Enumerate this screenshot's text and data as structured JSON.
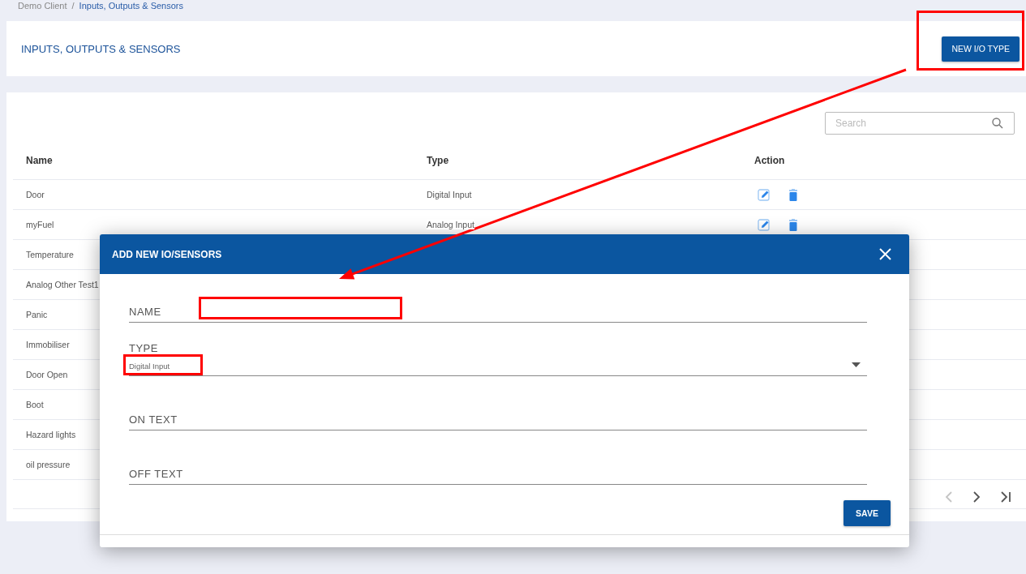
{
  "breadcrumb": {
    "items": [
      "Demo Client",
      "Inputs, Outputs & Sensors"
    ],
    "separator": "/"
  },
  "header": {
    "title": "INPUTS, OUTPUTS & SENSORS",
    "button": "NEW I/O TYPE"
  },
  "search": {
    "placeholder": "Search"
  },
  "table": {
    "columns": [
      "Name",
      "Type",
      "Action"
    ],
    "rows": [
      {
        "name": "Door",
        "type": "Digital Input",
        "actions": true
      },
      {
        "name": "myFuel",
        "type": "Analog Input",
        "actions": true
      },
      {
        "name": "Temperature"
      },
      {
        "name": "Analog Other Test1"
      },
      {
        "name": "Panic"
      },
      {
        "name": "Immobiliser"
      },
      {
        "name": "Door Open"
      },
      {
        "name": "Boot"
      },
      {
        "name": "Hazard lights"
      },
      {
        "name": "oil pressure"
      }
    ]
  },
  "pagination": [
    {
      "kind": "previous",
      "disabled": true
    },
    {
      "kind": "next",
      "disabled": false
    },
    {
      "kind": "last",
      "disabled": false
    }
  ],
  "dialog": {
    "title": "ADD NEW IO/SENSORS",
    "fields": [
      {
        "kind": "text",
        "label": "NAME"
      },
      {
        "kind": "select",
        "label": "TYPE",
        "value": "Digital Input"
      },
      {
        "kind": "text",
        "label": "ON TEXT"
      },
      {
        "kind": "text",
        "label": "OFF TEXT"
      }
    ],
    "button": "SAVE"
  }
}
